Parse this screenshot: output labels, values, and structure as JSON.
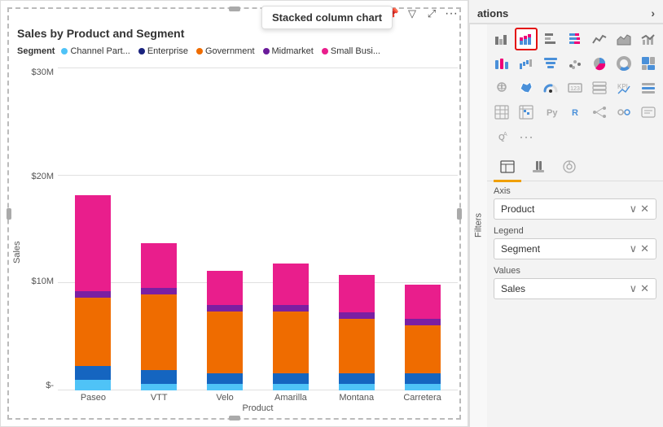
{
  "tooltip": {
    "text": "Stacked column chart"
  },
  "chart": {
    "title": "Sales by Product and Segment",
    "legend_label": "Segment",
    "legend_items": [
      {
        "label": "Channel Part...",
        "color": "#4fc3f7"
      },
      {
        "label": "Enterprise",
        "color": "#1a237e"
      },
      {
        "label": "Government",
        "color": "#ef6c00"
      },
      {
        "label": "Midmarket",
        "color": "#6a1b9a"
      },
      {
        "label": "Small Busi...",
        "color": "#e91e8c"
      }
    ],
    "y_axis_label": "Sales",
    "x_axis_label": "Product",
    "y_ticks": [
      "$-",
      "$10M",
      "$20M",
      "$30M"
    ],
    "bars": [
      {
        "label": "Paseo",
        "segments": [
          {
            "color": "#4fc3f7",
            "height": 0.03
          },
          {
            "color": "#1565c0",
            "height": 0.04
          },
          {
            "color": "#ef6c00",
            "height": 0.2
          },
          {
            "color": "#7b1fa2",
            "height": 0.02
          },
          {
            "color": "#e91e8c",
            "height": 0.28
          }
        ]
      },
      {
        "label": "VTT",
        "segments": [
          {
            "color": "#4fc3f7",
            "height": 0.02
          },
          {
            "color": "#1565c0",
            "height": 0.04
          },
          {
            "color": "#ef6c00",
            "height": 0.22
          },
          {
            "color": "#7b1fa2",
            "height": 0.02
          },
          {
            "color": "#e91e8c",
            "height": 0.13
          }
        ]
      },
      {
        "label": "Velo",
        "segments": [
          {
            "color": "#4fc3f7",
            "height": 0.02
          },
          {
            "color": "#1565c0",
            "height": 0.03
          },
          {
            "color": "#ef6c00",
            "height": 0.18
          },
          {
            "color": "#7b1fa2",
            "height": 0.02
          },
          {
            "color": "#e91e8c",
            "height": 0.1
          }
        ]
      },
      {
        "label": "Amarilla",
        "segments": [
          {
            "color": "#4fc3f7",
            "height": 0.02
          },
          {
            "color": "#1565c0",
            "height": 0.03
          },
          {
            "color": "#ef6c00",
            "height": 0.18
          },
          {
            "color": "#7b1fa2",
            "height": 0.02
          },
          {
            "color": "#e91e8c",
            "height": 0.12
          }
        ]
      },
      {
        "label": "Montana",
        "segments": [
          {
            "color": "#4fc3f7",
            "height": 0.02
          },
          {
            "color": "#1565c0",
            "height": 0.03
          },
          {
            "color": "#ef6c00",
            "height": 0.16
          },
          {
            "color": "#7b1fa2",
            "height": 0.02
          },
          {
            "color": "#e91e8c",
            "height": 0.11
          }
        ]
      },
      {
        "label": "Carretera",
        "segments": [
          {
            "color": "#4fc3f7",
            "height": 0.02
          },
          {
            "color": "#1565c0",
            "height": 0.03
          },
          {
            "color": "#ef6c00",
            "height": 0.14
          },
          {
            "color": "#7b1fa2",
            "height": 0.02
          },
          {
            "color": "#e91e8c",
            "height": 0.1
          }
        ]
      }
    ]
  },
  "panel": {
    "header": "ations",
    "filters_label": "Filters",
    "format_tabs": [
      {
        "icon": "⊞",
        "label": "fields"
      },
      {
        "icon": "🖌",
        "label": "format"
      },
      {
        "icon": "🔍",
        "label": "analytics"
      }
    ],
    "axis_label": "Axis",
    "axis_value": "Product",
    "legend_label": "Legend",
    "legend_value": "Segment",
    "values_label": "Values",
    "values_value": "Sales",
    "icon_grid": [
      "bar-chart",
      "stacked-col",
      "clustered-bar",
      "line-chart",
      "line-clustered",
      "area-chart",
      "scatter",
      "pie-chart",
      "donut-chart",
      "treemap",
      "map-chart",
      "filled-map",
      "funnel",
      "gauge",
      {
        "icon": "table",
        "selected": false
      },
      "matrix",
      "card",
      "multi-card",
      "kpi",
      "slicer",
      "image",
      "text-box",
      "shape",
      "py-visual",
      "r-visual",
      "decomp-tree",
      "key-influencer",
      "smart-narrative",
      "qa-visual",
      "more-visuals"
    ]
  }
}
